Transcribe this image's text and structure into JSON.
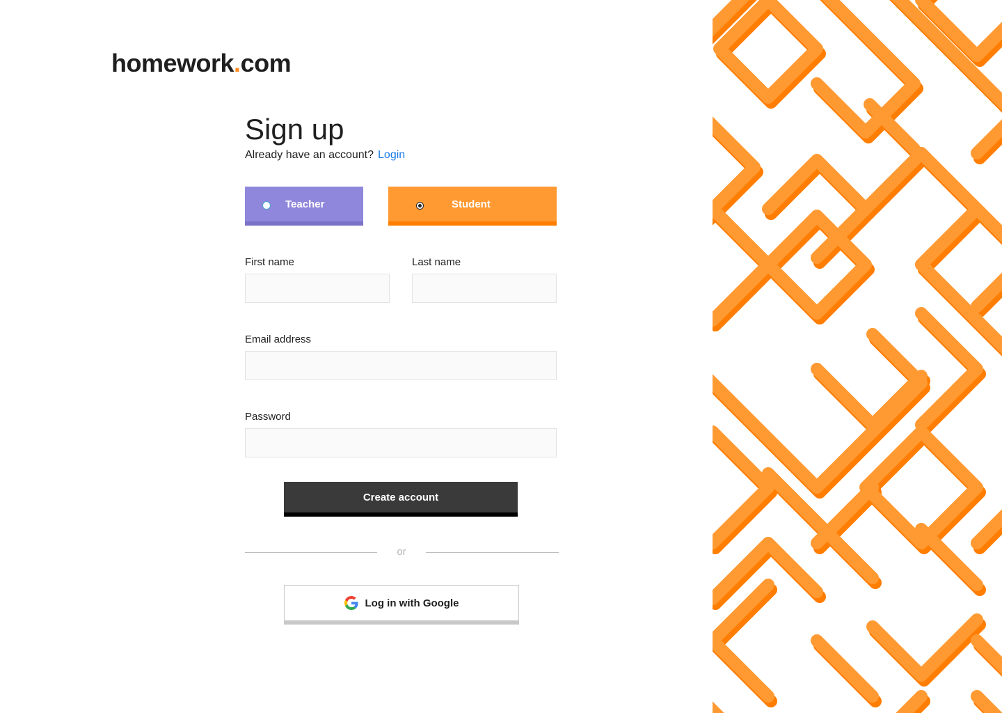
{
  "brand": {
    "name": "homework",
    "dot": ".",
    "tld": "com",
    "accent": "#ff8a1f"
  },
  "signup": {
    "title": "Sign up",
    "already_text": "Already have an account?",
    "login_label": "Login"
  },
  "roles": [
    {
      "label": "Teacher",
      "selected": false,
      "color": "#8f87db"
    },
    {
      "label": "Student",
      "selected": true,
      "color": "#ff9a33"
    }
  ],
  "fields": {
    "first_name": {
      "label": "First name",
      "value": ""
    },
    "last_name": {
      "label": "Last name",
      "value": ""
    },
    "email": {
      "label": "Email address",
      "value": ""
    },
    "password": {
      "label": "Password",
      "value": ""
    }
  },
  "actions": {
    "create_label": "Create account",
    "or_label": "or",
    "google_label": "Log in with Google"
  },
  "decor": {
    "pattern_color": "#ff9a33",
    "pattern_shadow": "#ff7d00"
  }
}
